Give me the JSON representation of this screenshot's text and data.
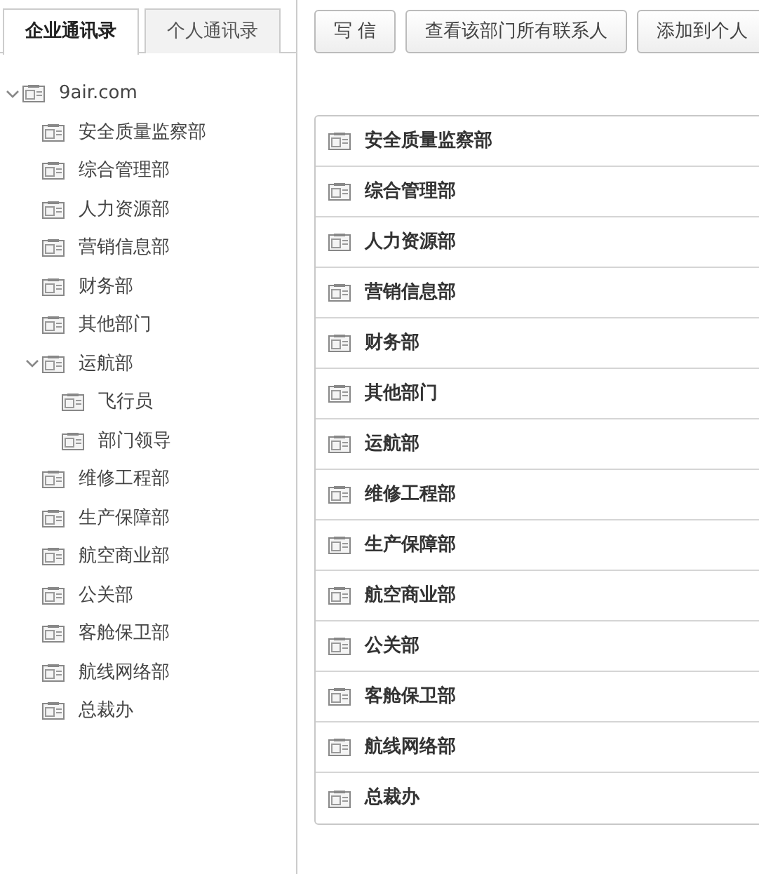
{
  "tabs": [
    {
      "label": "企业通讯录",
      "selected": true
    },
    {
      "label": "个人通讯录",
      "selected": false
    }
  ],
  "tree": [
    {
      "label": "9air.com",
      "expanded": true,
      "children": [
        {
          "label": "安全质量监察部"
        },
        {
          "label": "综合管理部"
        },
        {
          "label": "人力资源部"
        },
        {
          "label": "营销信息部"
        },
        {
          "label": "财务部"
        },
        {
          "label": "其他部门"
        },
        {
          "label": "运航部",
          "expanded": true,
          "children": [
            {
              "label": "飞行员"
            },
            {
              "label": "部门领导"
            }
          ]
        },
        {
          "label": "维修工程部"
        },
        {
          "label": "生产保障部"
        },
        {
          "label": "航空商业部"
        },
        {
          "label": "公关部"
        },
        {
          "label": "客舱保卫部"
        },
        {
          "label": "航线网络部"
        },
        {
          "label": "总裁办"
        }
      ]
    }
  ],
  "toolbar": [
    "写 信",
    "查看该部门所有联系人",
    "添加到个人"
  ],
  "departments": [
    "安全质量监察部",
    "综合管理部",
    "人力资源部",
    "营销信息部",
    "财务部",
    "其他部门",
    "运航部",
    "维修工程部",
    "生产保障部",
    "航空商业部",
    "公关部",
    "客舱保卫部",
    "航线网络部",
    "总裁办"
  ]
}
